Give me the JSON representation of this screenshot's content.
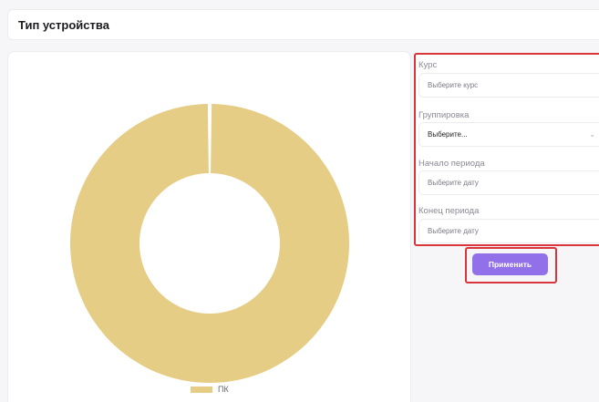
{
  "header": {
    "title": "Тип устройства"
  },
  "filters": {
    "course": {
      "label": "Курс",
      "placeholder": "Выберите курс"
    },
    "grouping": {
      "label": "Группировка",
      "value": "Выберите..."
    },
    "period_start": {
      "label": "Начало периода",
      "placeholder": "Выберите дату"
    },
    "period_end": {
      "label": "Конец периода",
      "placeholder": "Выберите дату"
    }
  },
  "apply_label": "Применить",
  "colors": {
    "slice": "#e6cd86",
    "accent": "#9170e9",
    "highlight": "#d9353a"
  },
  "chart_data": {
    "type": "pie",
    "donut": true,
    "categories": [
      "ПК"
    ],
    "values": [
      100
    ],
    "legend": "bottom"
  }
}
